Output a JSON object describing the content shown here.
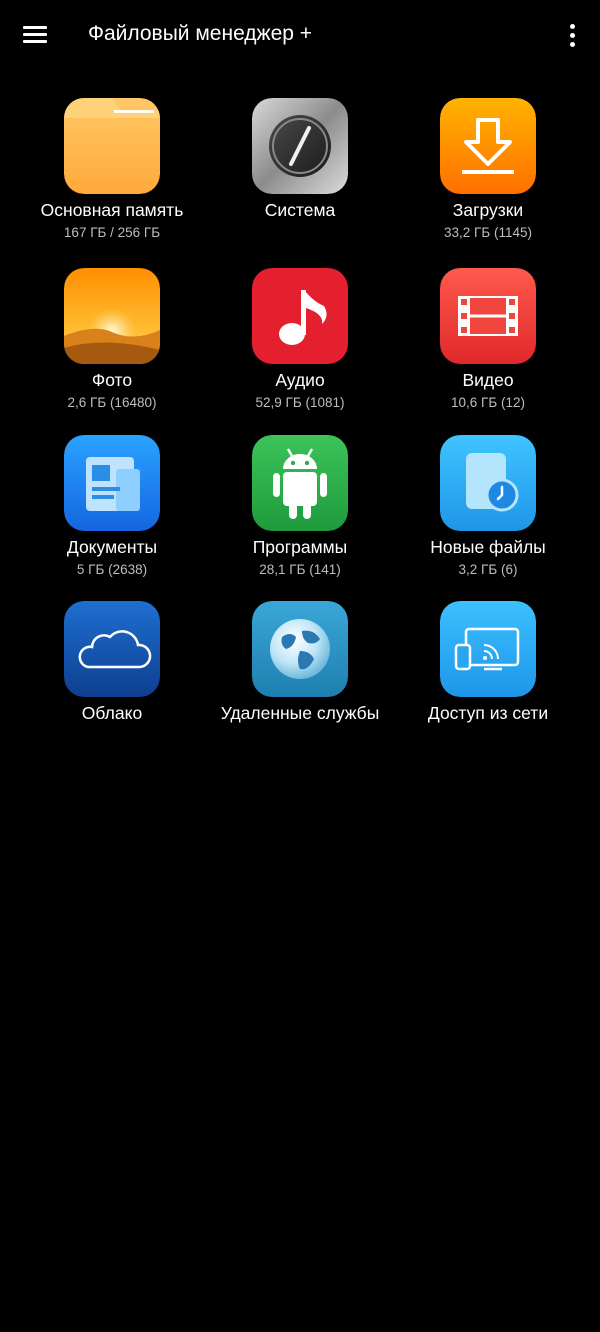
{
  "app": {
    "title": "Файловый менеджер +"
  },
  "categories": [
    {
      "label": "Основная память",
      "sub": "167 ГБ / 256 ГБ",
      "icon": "folder-icon"
    },
    {
      "label": "Система",
      "sub": "",
      "icon": "system-icon"
    },
    {
      "label": "Загрузки",
      "sub": "33,2 ГБ (1145)",
      "icon": "download-icon"
    },
    {
      "label": "Фото",
      "sub": "2,6 ГБ (16480)",
      "icon": "photo-icon"
    },
    {
      "label": "Аудио",
      "sub": "52,9 ГБ (1081)",
      "icon": "music-note-icon"
    },
    {
      "label": "Видео",
      "sub": "10,6 ГБ (12)",
      "icon": "film-icon"
    },
    {
      "label": "Документы",
      "sub": "5 ГБ (2638)",
      "icon": "document-icon"
    },
    {
      "label": "Программы",
      "sub": "28,1 ГБ (141)",
      "icon": "android-icon"
    },
    {
      "label": "Новые файлы",
      "sub": "3,2 ГБ (6)",
      "icon": "new-files-icon"
    },
    {
      "label": "Облако",
      "sub": "",
      "icon": "cloud-icon"
    },
    {
      "label": "Удаленные службы",
      "sub": "",
      "icon": "globe-icon"
    },
    {
      "label": "Доступ из сети",
      "sub": "",
      "icon": "network-access-icon"
    }
  ],
  "colors": {
    "background": "#000000",
    "folder": "#ffb74d",
    "downloads": "#ff9800",
    "audio": "#e5202e",
    "video": "#f44336",
    "documents": "#1e88e5",
    "programs": "#2eae4a",
    "new_files": "#29b6f6",
    "cloud": "#1565c0",
    "remote": "#2a8fc0",
    "network": "#29b6f6"
  }
}
